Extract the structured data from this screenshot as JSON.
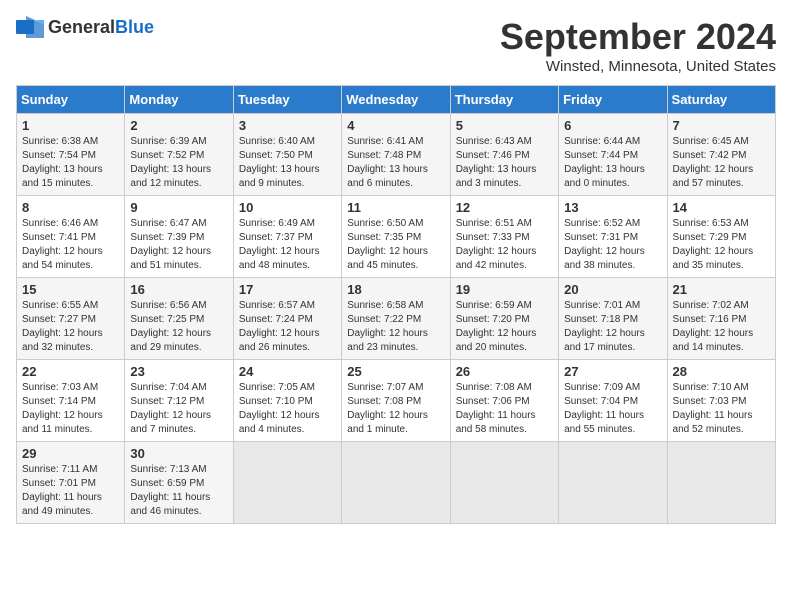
{
  "header": {
    "logo_general": "General",
    "logo_blue": "Blue",
    "month": "September 2024",
    "location": "Winsted, Minnesota, United States"
  },
  "weekdays": [
    "Sunday",
    "Monday",
    "Tuesday",
    "Wednesday",
    "Thursday",
    "Friday",
    "Saturday"
  ],
  "weeks": [
    [
      {
        "day": "1",
        "sunrise": "6:38 AM",
        "sunset": "7:54 PM",
        "daylight": "13 hours and 15 minutes."
      },
      {
        "day": "2",
        "sunrise": "6:39 AM",
        "sunset": "7:52 PM",
        "daylight": "13 hours and 12 minutes."
      },
      {
        "day": "3",
        "sunrise": "6:40 AM",
        "sunset": "7:50 PM",
        "daylight": "13 hours and 9 minutes."
      },
      {
        "day": "4",
        "sunrise": "6:41 AM",
        "sunset": "7:48 PM",
        "daylight": "13 hours and 6 minutes."
      },
      {
        "day": "5",
        "sunrise": "6:43 AM",
        "sunset": "7:46 PM",
        "daylight": "13 hours and 3 minutes."
      },
      {
        "day": "6",
        "sunrise": "6:44 AM",
        "sunset": "7:44 PM",
        "daylight": "13 hours and 0 minutes."
      },
      {
        "day": "7",
        "sunrise": "6:45 AM",
        "sunset": "7:42 PM",
        "daylight": "12 hours and 57 minutes."
      }
    ],
    [
      {
        "day": "8",
        "sunrise": "6:46 AM",
        "sunset": "7:41 PM",
        "daylight": "12 hours and 54 minutes."
      },
      {
        "day": "9",
        "sunrise": "6:47 AM",
        "sunset": "7:39 PM",
        "daylight": "12 hours and 51 minutes."
      },
      {
        "day": "10",
        "sunrise": "6:49 AM",
        "sunset": "7:37 PM",
        "daylight": "12 hours and 48 minutes."
      },
      {
        "day": "11",
        "sunrise": "6:50 AM",
        "sunset": "7:35 PM",
        "daylight": "12 hours and 45 minutes."
      },
      {
        "day": "12",
        "sunrise": "6:51 AM",
        "sunset": "7:33 PM",
        "daylight": "12 hours and 42 minutes."
      },
      {
        "day": "13",
        "sunrise": "6:52 AM",
        "sunset": "7:31 PM",
        "daylight": "12 hours and 38 minutes."
      },
      {
        "day": "14",
        "sunrise": "6:53 AM",
        "sunset": "7:29 PM",
        "daylight": "12 hours and 35 minutes."
      }
    ],
    [
      {
        "day": "15",
        "sunrise": "6:55 AM",
        "sunset": "7:27 PM",
        "daylight": "12 hours and 32 minutes."
      },
      {
        "day": "16",
        "sunrise": "6:56 AM",
        "sunset": "7:25 PM",
        "daylight": "12 hours and 29 minutes."
      },
      {
        "day": "17",
        "sunrise": "6:57 AM",
        "sunset": "7:24 PM",
        "daylight": "12 hours and 26 minutes."
      },
      {
        "day": "18",
        "sunrise": "6:58 AM",
        "sunset": "7:22 PM",
        "daylight": "12 hours and 23 minutes."
      },
      {
        "day": "19",
        "sunrise": "6:59 AM",
        "sunset": "7:20 PM",
        "daylight": "12 hours and 20 minutes."
      },
      {
        "day": "20",
        "sunrise": "7:01 AM",
        "sunset": "7:18 PM",
        "daylight": "12 hours and 17 minutes."
      },
      {
        "day": "21",
        "sunrise": "7:02 AM",
        "sunset": "7:16 PM",
        "daylight": "12 hours and 14 minutes."
      }
    ],
    [
      {
        "day": "22",
        "sunrise": "7:03 AM",
        "sunset": "7:14 PM",
        "daylight": "12 hours and 11 minutes."
      },
      {
        "day": "23",
        "sunrise": "7:04 AM",
        "sunset": "7:12 PM",
        "daylight": "12 hours and 7 minutes."
      },
      {
        "day": "24",
        "sunrise": "7:05 AM",
        "sunset": "7:10 PM",
        "daylight": "12 hours and 4 minutes."
      },
      {
        "day": "25",
        "sunrise": "7:07 AM",
        "sunset": "7:08 PM",
        "daylight": "12 hours and 1 minute."
      },
      {
        "day": "26",
        "sunrise": "7:08 AM",
        "sunset": "7:06 PM",
        "daylight": "11 hours and 58 minutes."
      },
      {
        "day": "27",
        "sunrise": "7:09 AM",
        "sunset": "7:04 PM",
        "daylight": "11 hours and 55 minutes."
      },
      {
        "day": "28",
        "sunrise": "7:10 AM",
        "sunset": "7:03 PM",
        "daylight": "11 hours and 52 minutes."
      }
    ],
    [
      {
        "day": "29",
        "sunrise": "7:11 AM",
        "sunset": "7:01 PM",
        "daylight": "11 hours and 49 minutes."
      },
      {
        "day": "30",
        "sunrise": "7:13 AM",
        "sunset": "6:59 PM",
        "daylight": "11 hours and 46 minutes."
      },
      null,
      null,
      null,
      null,
      null
    ]
  ]
}
